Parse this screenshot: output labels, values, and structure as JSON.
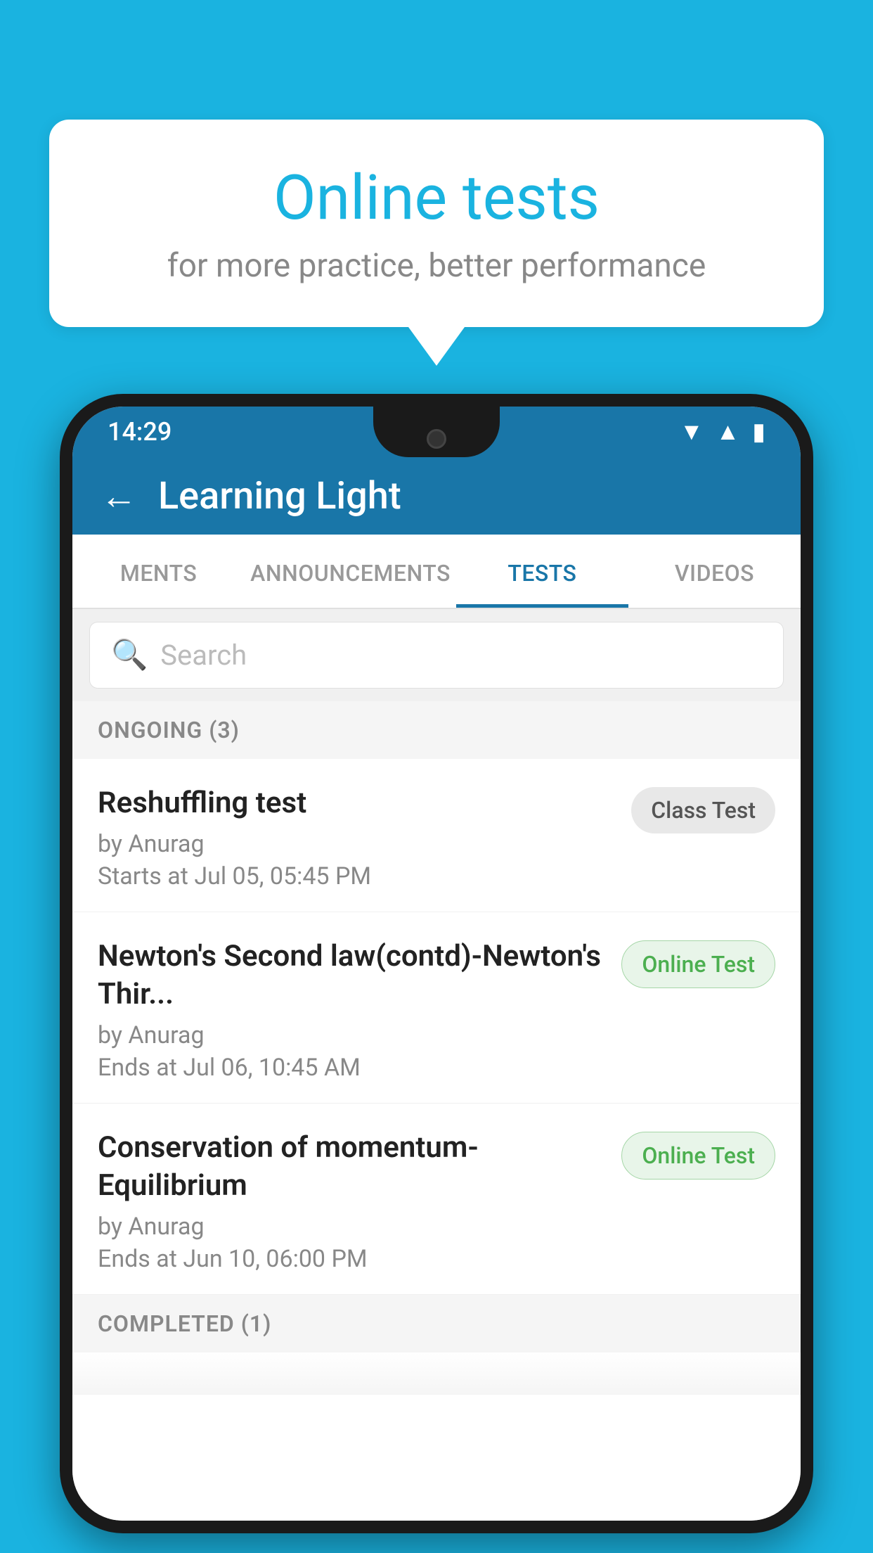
{
  "background_color": "#1ab3e0",
  "speech_bubble": {
    "title": "Online tests",
    "subtitle": "for more practice, better performance"
  },
  "phone": {
    "status_bar": {
      "time": "14:29",
      "icons": [
        "wifi",
        "signal",
        "battery"
      ]
    },
    "app_bar": {
      "title": "Learning Light",
      "back_label": "←"
    },
    "tabs": [
      {
        "label": "MENTS",
        "active": false
      },
      {
        "label": "ANNOUNCEMENTS",
        "active": false
      },
      {
        "label": "TESTS",
        "active": true
      },
      {
        "label": "VIDEOS",
        "active": false
      }
    ],
    "search": {
      "placeholder": "Search"
    },
    "ongoing_section": {
      "label": "ONGOING (3)"
    },
    "tests": [
      {
        "name": "Reshuffling test",
        "by": "by Anurag",
        "date_label": "Starts at",
        "date": "Jul 05, 05:45 PM",
        "badge": "Class Test",
        "badge_type": "class"
      },
      {
        "name": "Newton's Second law(contd)-Newton's Thir...",
        "by": "by Anurag",
        "date_label": "Ends at",
        "date": "Jul 06, 10:45 AM",
        "badge": "Online Test",
        "badge_type": "online"
      },
      {
        "name": "Conservation of momentum-Equilibrium",
        "by": "by Anurag",
        "date_label": "Ends at",
        "date": "Jun 10, 06:00 PM",
        "badge": "Online Test",
        "badge_type": "online"
      }
    ],
    "completed_section": {
      "label": "COMPLETED (1)"
    }
  }
}
